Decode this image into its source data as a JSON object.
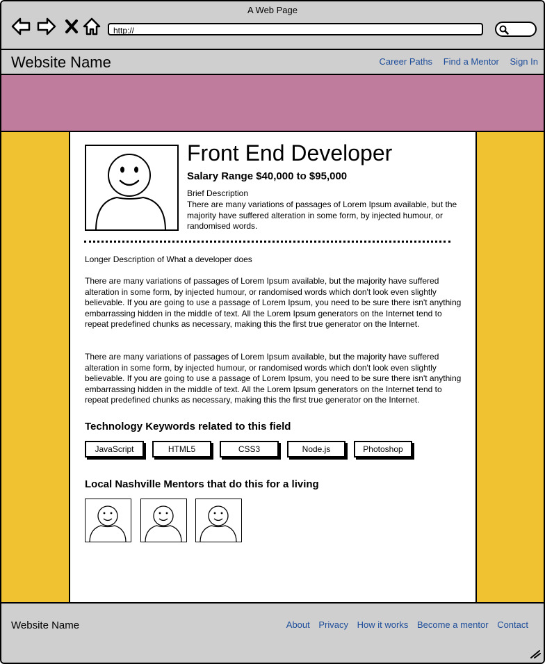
{
  "window": {
    "title": "A Web Page",
    "url": "http://"
  },
  "header": {
    "site_name": "Website Name",
    "nav": [
      "Career Paths",
      "Find a Mentor",
      "Sign In"
    ]
  },
  "profile": {
    "title": "Front End Developer",
    "salary": "Salary Range $40,000 to $95,000",
    "brief_label": "Brief Description",
    "brief_text": "There are many variations of passages of Lorem Ipsum available, but the majority have suffered alteration in some form, by injected humour, or randomised words.",
    "longer_label": "Longer Description of What a developer does",
    "paragraphs": [
      "There are many variations of passages of Lorem Ipsum available, but the majority have suffered alteration in some form, by injected humour, or randomised words which don't look even slightly believable. If you are going to use a passage of Lorem Ipsum, you need to be sure there isn't anything embarrassing hidden in the middle of text. All the Lorem Ipsum generators on the Internet tend to repeat predefined chunks as necessary, making this the first true generator on the Internet.",
      "There are many variations of passages of Lorem Ipsum available, but the majority have suffered alteration in some form, by injected humour, or randomised words which don't look even slightly believable. If you are going to use a passage of Lorem Ipsum, you need to be sure there isn't anything embarrassing hidden in the middle of text. All the Lorem Ipsum generators on the Internet tend to repeat predefined chunks as necessary, making this the first true generator on the Internet."
    ],
    "tech_heading": "Technology Keywords related to this field",
    "tags": [
      "JavaScript",
      "HTML5",
      "CSS3",
      "Node.js",
      "Photoshop"
    ],
    "mentors_heading": "Local Nashville Mentors that do this for a living"
  },
  "footer": {
    "site_name": "Website Name",
    "links": [
      "About",
      "Privacy",
      "How it works",
      "Become a mentor",
      "Contact"
    ]
  },
  "colors": {
    "banner": "#c07c9d",
    "sidebar": "#f0c131",
    "chrome": "#cfcfcf",
    "link": "#1f4e9b"
  }
}
